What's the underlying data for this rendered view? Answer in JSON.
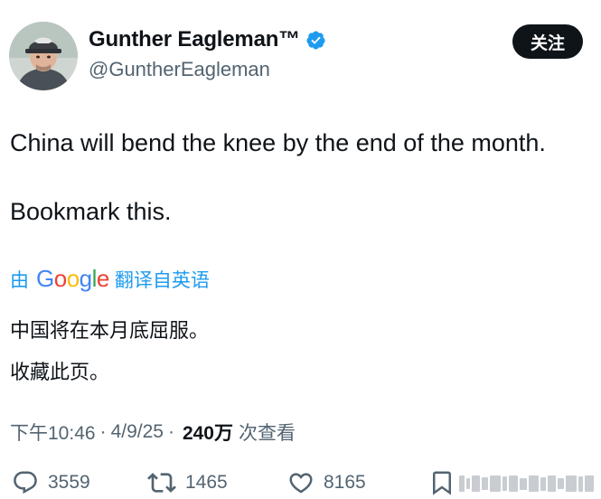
{
  "author": {
    "display_name": "Gunther Eagleman™",
    "handle": "@GuntherEagleman",
    "avatar_icon": "user-avatar",
    "verified_icon": "verified-badge-icon",
    "verified_color": "#1d9bf0"
  },
  "follow_button": {
    "label": "关注"
  },
  "tweet": {
    "line1": "China will bend the knee by the end of the month.",
    "line2": "Bookmark this."
  },
  "translation": {
    "by": "由",
    "provider": "Google",
    "action": "翻译自英语",
    "line1": "中国将在本月底屈服。",
    "line2": "收藏此页。",
    "link_color": "#1d9bf0"
  },
  "meta": {
    "time": "下午10:46",
    "separator": "·",
    "date": "4/9/25",
    "views_count": "240万",
    "views_label": "次查看"
  },
  "actions": {
    "reply": {
      "icon": "reply-icon",
      "count": "3559"
    },
    "retweet": {
      "icon": "retweet-icon",
      "count": "1465"
    },
    "like": {
      "icon": "heart-icon",
      "count": "8165"
    },
    "bookmark": {
      "icon": "bookmark-icon"
    }
  },
  "colors": {
    "text_primary": "#0f1419",
    "text_secondary": "#536471",
    "accent": "#1d9bf0"
  }
}
